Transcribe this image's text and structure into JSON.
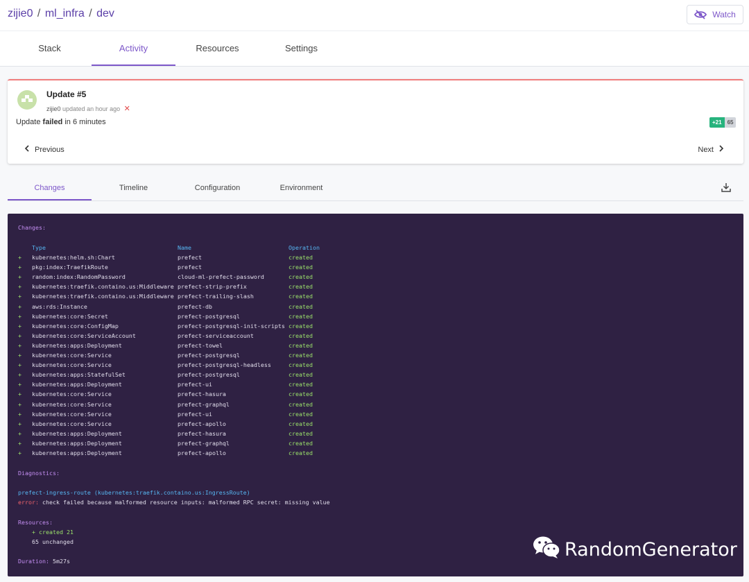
{
  "breadcrumb": {
    "org": "zijie0",
    "project": "ml_infra",
    "stack": "dev",
    "sep": "/"
  },
  "watch_button": {
    "label": "Watch",
    "icon": "eye-off-icon"
  },
  "main_tabs": [
    {
      "label": "Stack"
    },
    {
      "label": "Activity",
      "active": true
    },
    {
      "label": "Resources"
    },
    {
      "label": "Settings"
    }
  ],
  "update": {
    "title": "Update #5",
    "user": "zijie0",
    "meta": "updated an hour ago",
    "fail_mark": "✕",
    "status_prefix": "Update",
    "status_word": "failed",
    "status_suffix": "in 6 minutes",
    "created_badge": "+21",
    "unchanged_badge": "65",
    "prev_label": "Previous",
    "next_label": "Next"
  },
  "sub_tabs": [
    {
      "label": "Changes",
      "active": true
    },
    {
      "label": "Timeline"
    },
    {
      "label": "Configuration"
    },
    {
      "label": "Environment"
    }
  ],
  "terminal": {
    "changes_heading": "Changes:",
    "columns": {
      "type": "Type",
      "name": "Name",
      "operation": "Operation"
    },
    "rows": [
      {
        "sign": "+",
        "type": "kubernetes:helm.sh:Chart",
        "name": "prefect",
        "op": "created"
      },
      {
        "sign": "+",
        "type": "pkg:index:TraefikRoute",
        "name": "prefect",
        "op": "created"
      },
      {
        "sign": "+",
        "type": "random:index:RandomPassword",
        "name": "cloud-ml-prefect-password",
        "op": "created"
      },
      {
        "sign": "+",
        "type": "kubernetes:traefik.containo.us:Middleware",
        "name": "prefect-strip-prefix",
        "op": "created"
      },
      {
        "sign": "+",
        "type": "kubernetes:traefik.containo.us:Middleware",
        "name": "prefect-trailing-slash",
        "op": "created"
      },
      {
        "sign": "+",
        "type": "aws:rds:Instance",
        "name": "prefect-db",
        "op": "created"
      },
      {
        "sign": "+",
        "type": "kubernetes:core:Secret",
        "name": "prefect-postgresql",
        "op": "created"
      },
      {
        "sign": "+",
        "type": "kubernetes:core:ConfigMap",
        "name": "prefect-postgresql-init-scripts",
        "op": "created"
      },
      {
        "sign": "+",
        "type": "kubernetes:core:ServiceAccount",
        "name": "prefect-serviceaccount",
        "op": "created"
      },
      {
        "sign": "+",
        "type": "kubernetes:apps:Deployment",
        "name": "prefect-towel",
        "op": "created"
      },
      {
        "sign": "+",
        "type": "kubernetes:core:Service",
        "name": "prefect-postgresql",
        "op": "created"
      },
      {
        "sign": "+",
        "type": "kubernetes:core:Service",
        "name": "prefect-postgresql-headless",
        "op": "created"
      },
      {
        "sign": "+",
        "type": "kubernetes:apps:StatefulSet",
        "name": "prefect-postgresql",
        "op": "created"
      },
      {
        "sign": "+",
        "type": "kubernetes:apps:Deployment",
        "name": "prefect-ui",
        "op": "created"
      },
      {
        "sign": "+",
        "type": "kubernetes:core:Service",
        "name": "prefect-hasura",
        "op": "created"
      },
      {
        "sign": "+",
        "type": "kubernetes:core:Service",
        "name": "prefect-graphql",
        "op": "created"
      },
      {
        "sign": "+",
        "type": "kubernetes:core:Service",
        "name": "prefect-ui",
        "op": "created"
      },
      {
        "sign": "+",
        "type": "kubernetes:core:Service",
        "name": "prefect-apollo",
        "op": "created"
      },
      {
        "sign": "+",
        "type": "kubernetes:apps:Deployment",
        "name": "prefect-hasura",
        "op": "created"
      },
      {
        "sign": "+",
        "type": "kubernetes:apps:Deployment",
        "name": "prefect-graphql",
        "op": "created"
      },
      {
        "sign": "+",
        "type": "kubernetes:apps:Deployment",
        "name": "prefect-apollo",
        "op": "created"
      }
    ],
    "diagnostics_heading": "Diagnostics:",
    "diag_resource": "prefect-ingress-route (kubernetes:traefik.containo.us:IngressRoute)",
    "diag_error_label": "error:",
    "diag_error_msg": "check failed because malformed resource inputs: malformed RPC secret: missing value",
    "resources_heading": "Resources:",
    "res_created": "+ created 21",
    "res_unchanged": "65 unchanged",
    "duration_label": "Duration:",
    "duration_value": "5m27s"
  },
  "watermark": {
    "text": "RandomGenerator",
    "icon": "wechat-icon"
  },
  "colors": {
    "accent": "#7d57c9",
    "terminal_bg": "#2f2143",
    "created": "#9ce36b",
    "error": "#f0626b",
    "header": "#56b6f2"
  }
}
